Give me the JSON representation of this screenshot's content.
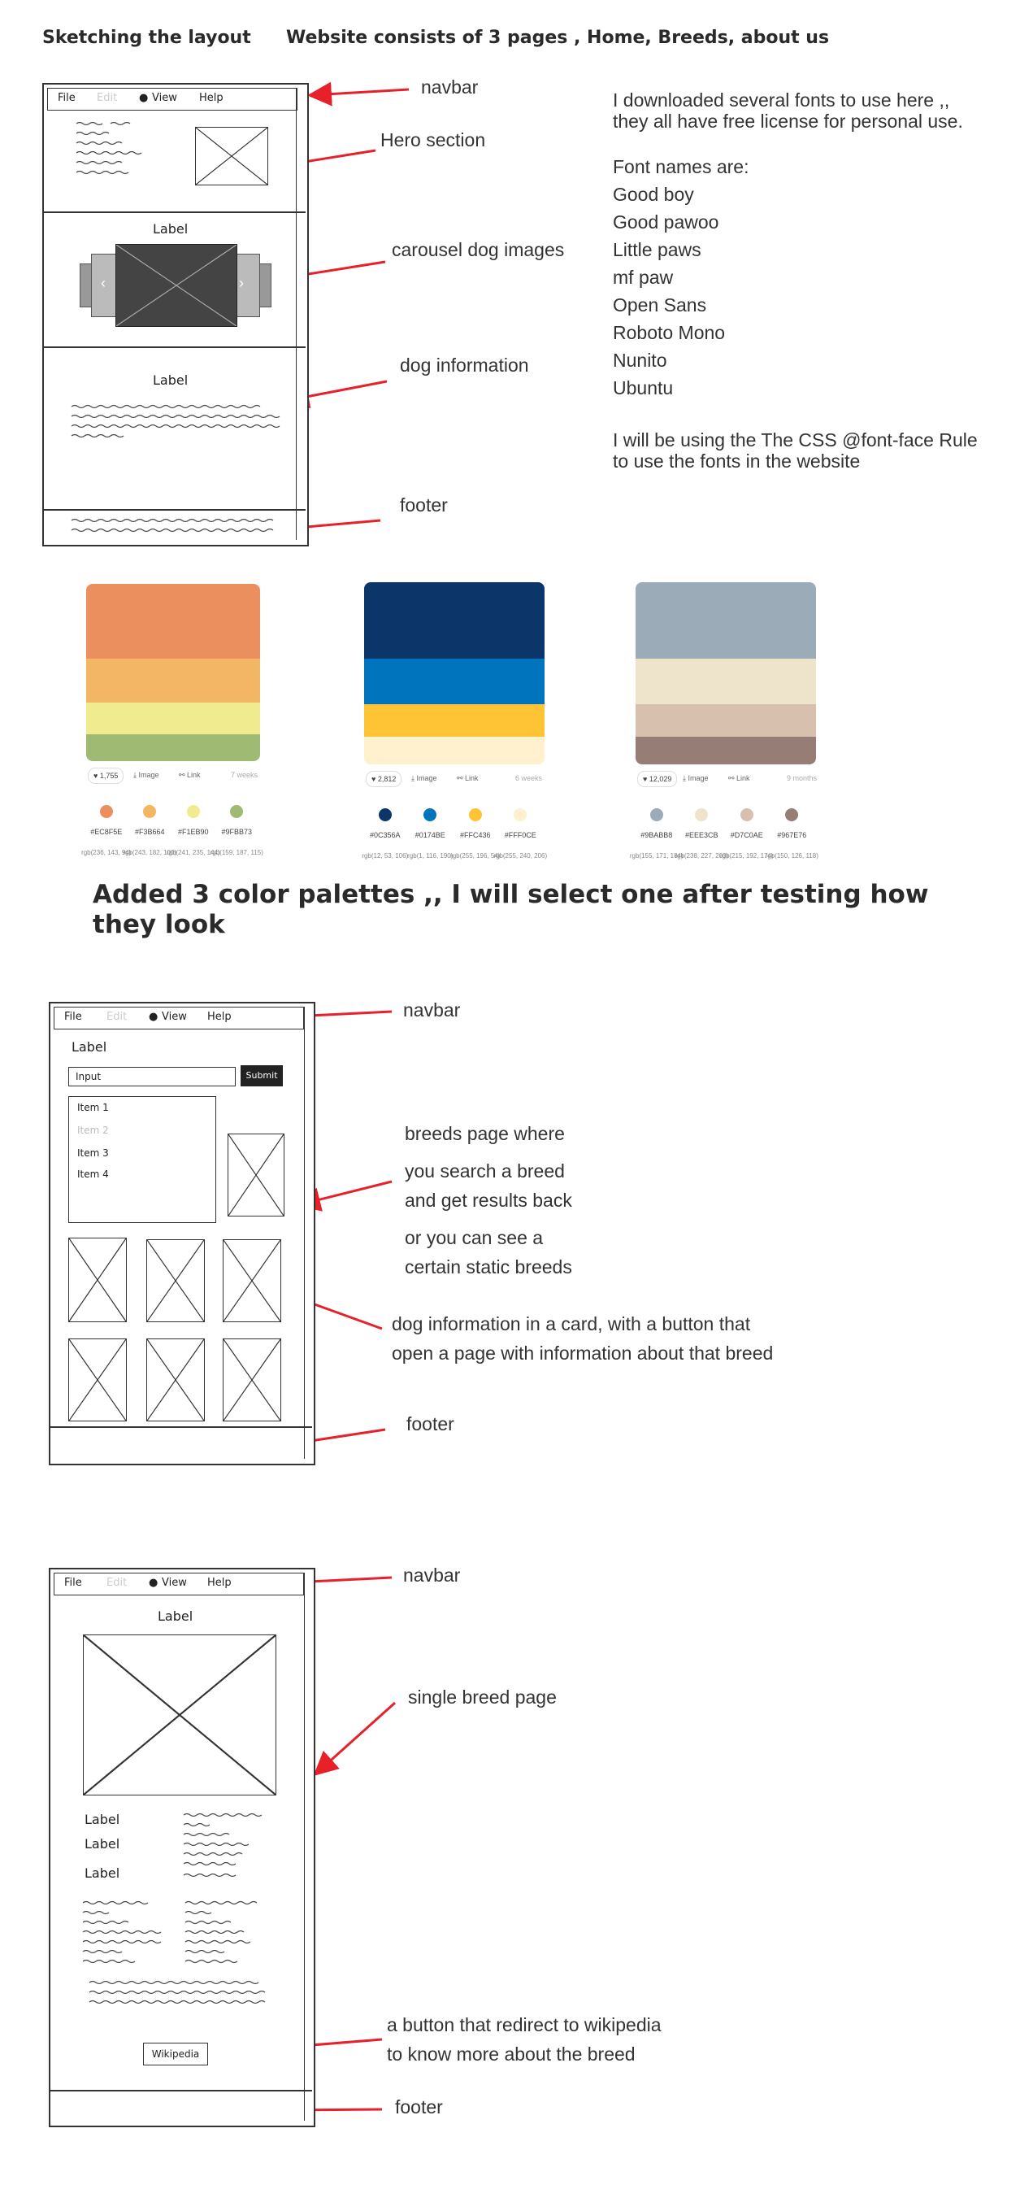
{
  "header": {
    "left_title": "Sketching the layout",
    "right_title": "Website consists of 3 pages , Home, Breeds, about us"
  },
  "nav": {
    "file": "File",
    "edit": "Edit",
    "view": "View",
    "help": "Help"
  },
  "home_annotations": {
    "navbar": "navbar",
    "hero": "Hero section",
    "carousel": "carousel dog images",
    "dog_info": "dog information",
    "footer": "footer"
  },
  "home_sketch": {
    "carousel_label": "Label",
    "info_label": "Label"
  },
  "fonts_note": {
    "intro_1": "I downloaded several fonts to use here ,,",
    "intro_2": "they all have free license for personal use.",
    "list_title": "Font names are:",
    "fonts": [
      "Good boy",
      "Good pawoo",
      "Little paws",
      "mf paw",
      "Open Sans",
      "Roboto Mono",
      "Nunito",
      "Ubuntu"
    ],
    "outro_1": "I will be using the The CSS @font-face Rule",
    "outro_2": "to use the fonts in the website"
  },
  "palettes": [
    {
      "likes": "1,755",
      "image": "Image",
      "link": "Link",
      "age": "7 weeks",
      "colors": [
        "#EC8F5E",
        "#F3B664",
        "#F1EB90",
        "#9FBB73"
      ],
      "bands": [
        0.42,
        0.25,
        0.18,
        0.15
      ],
      "hex": [
        "#EC8F5E",
        "#F3B664",
        "#F1EB90",
        "#9FBB73"
      ],
      "rgb": [
        "rgb(236, 143, 94)",
        "rgb(243, 182, 100)",
        "rgb(241, 235, 144)",
        "rgb(159, 187, 115)"
      ]
    },
    {
      "likes": "2,812",
      "image": "Image",
      "link": "Link",
      "age": "6 weeks",
      "colors": [
        "#0C356A",
        "#0174BE",
        "#FFC436",
        "#FFF0CE"
      ],
      "bands": [
        0.42,
        0.25,
        0.18,
        0.15
      ],
      "hex": [
        "#0C356A",
        "#0174BE",
        "#FFC436",
        "#FFF0CE"
      ],
      "rgb": [
        "rgb(12, 53, 106)",
        "rgb(1, 116, 190)",
        "rgb(255, 196, 54)",
        "rgb(255, 240, 206)"
      ]
    },
    {
      "likes": "12,029",
      "image": "Image",
      "link": "Link",
      "age": "9 months",
      "colors": [
        "#9BABB8",
        "#EEE3CB",
        "#D7C0AE",
        "#967E76"
      ],
      "bands": [
        0.42,
        0.25,
        0.18,
        0.15
      ],
      "hex": [
        "#9BABB8",
        "#EEE3CB",
        "#D7C0AE",
        "#967E76"
      ],
      "rgb": [
        "rgb(155, 171, 184)",
        "rgb(238, 227, 203)",
        "rgb(215, 192, 174)",
        "rgb(150, 126, 118)"
      ]
    }
  ],
  "palette_caption": {
    "line_1": "Added 3 color palettes ,, I will select one after testing how",
    "line_2": "they look"
  },
  "breeds_sketch": {
    "label": "Label",
    "input": "Input",
    "submit": "Submit",
    "items": [
      "Item 1",
      "Item 2",
      "Item 3",
      "Item 4"
    ]
  },
  "breeds_annotations": {
    "navbar": "navbar",
    "line_1": "breeds page where",
    "line_2": "you search a breed",
    "line_3": "and get results back",
    "line_4": "or you can see a",
    "line_5": "certain static breeds",
    "card_1": "dog information in a card, with a button that",
    "card_2": "open a page with information about that breed",
    "footer": "footer"
  },
  "single_sketch": {
    "label_top": "Label",
    "labels": [
      "Label",
      "Label",
      "Label"
    ],
    "wiki_button": "Wikipedia"
  },
  "single_annotations": {
    "navbar": "navbar",
    "page": "single breed page",
    "wiki_1": "a button that redirect to wikipedia",
    "wiki_2": "to know more about the breed",
    "footer": "footer"
  },
  "colors": {
    "arrow": "#e8202a",
    "sketch": "#333333"
  }
}
